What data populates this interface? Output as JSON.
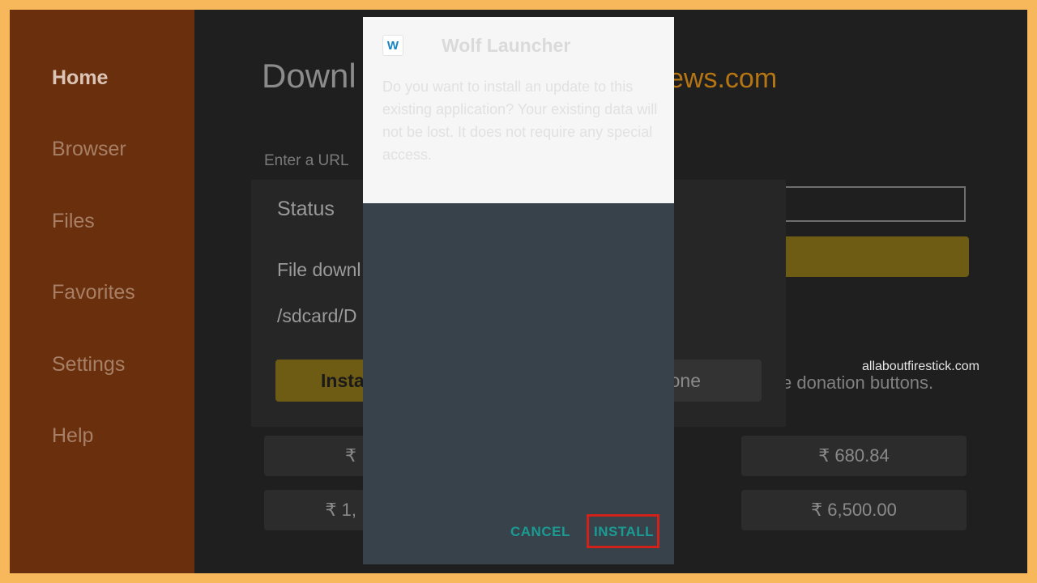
{
  "sidebar": {
    "items": [
      {
        "label": "Home"
      },
      {
        "label": "Browser"
      },
      {
        "label": "Files"
      },
      {
        "label": "Favorites"
      },
      {
        "label": "Settings"
      },
      {
        "label": "Help"
      }
    ]
  },
  "main": {
    "headline": "Downl",
    "headline_suffix": "ews.com",
    "url_label": "Enter a URL",
    "donation_text": "se donation buttons.",
    "donations": [
      "₹",
      "₹ 680.84",
      "₹ 1,",
      "₹ 6,500.00"
    ]
  },
  "status_dialog": {
    "title": "Status",
    "line1": "File downl",
    "line2": "/sdcard/D",
    "install_label": "Insta",
    "done_label": "Done"
  },
  "install_dialog": {
    "app_icon_letter": "W",
    "app_name": "Wolf Launcher",
    "description": "Do you want to install an update to this existing application? Your existing data will not be lost. It does not require any special access.",
    "cancel_label": "CANCEL",
    "install_label": "INSTALL"
  },
  "watermark": "allaboutfirestick.com",
  "colors": {
    "border": "#f7b85b",
    "sidebar": "#6a300d",
    "accent_teal": "#1a9b94",
    "highlight_red": "#d2201b"
  }
}
